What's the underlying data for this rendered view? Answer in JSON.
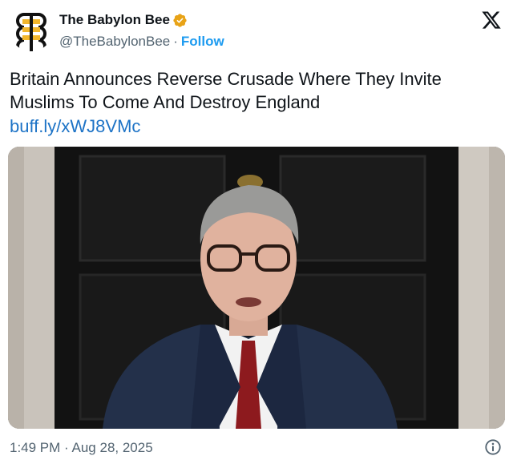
{
  "author": {
    "display_name": "The Babylon Bee",
    "handle": "@TheBabylonBee",
    "separator": "·",
    "follow_label": "Follow",
    "verified_badge_color": "#e8a317"
  },
  "tweet": {
    "text": "Britain Announces Reverse Crusade Where They Invite Muslims To Come And Destroy England",
    "link": "buff.ly/xWJ8VMc"
  },
  "footer": {
    "time": "1:49 PM",
    "separator": "·",
    "date": "Aug 28, 2025"
  },
  "colors": {
    "link": "#1d73c6",
    "follow": "#1d9bf0",
    "secondary_text": "#536471",
    "logo_yellow": "#f2b72d"
  },
  "icons": {
    "brand": "babylon-bee-logo",
    "platform": "x-logo",
    "verified": "verified-badge",
    "info": "info-icon"
  }
}
